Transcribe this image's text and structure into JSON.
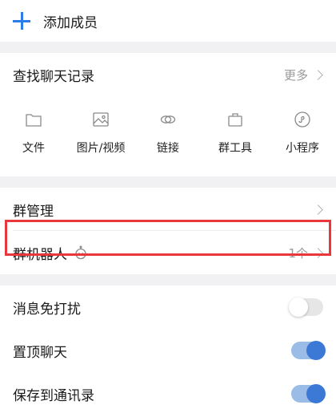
{
  "add_member": {
    "label": "添加成员",
    "icon": "plus-icon"
  },
  "search_history": {
    "title": "查找聊天记录",
    "more": "更多",
    "categories": [
      {
        "label": "文件",
        "icon": "folder-icon"
      },
      {
        "label": "图片/视频",
        "icon": "image-icon"
      },
      {
        "label": "链接",
        "icon": "link-icon"
      },
      {
        "label": "群工具",
        "icon": "briefcase-icon"
      },
      {
        "label": "小程序",
        "icon": "mini-program-icon"
      }
    ]
  },
  "group_management": {
    "label": "群管理"
  },
  "group_robot": {
    "label": "群机器人",
    "count": "1个",
    "icon": "robot-icon"
  },
  "settings": [
    {
      "label": "消息免打扰",
      "enabled": false
    },
    {
      "label": "置顶聊天",
      "enabled": true
    },
    {
      "label": "保存到通讯录",
      "enabled": true
    }
  ],
  "colors": {
    "accent": "#2a7ce6",
    "highlight": "#e8383d",
    "toggle_on": "#3c79d6"
  }
}
